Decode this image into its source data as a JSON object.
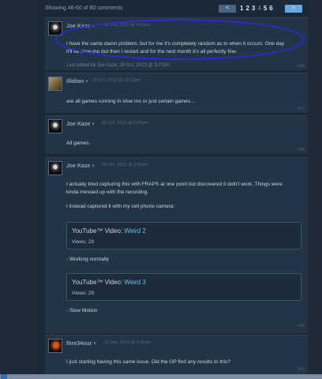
{
  "pager": {
    "showing": "Showing 46-60 of 80 comments",
    "prev": "<",
    "next": ">",
    "pages": [
      "1",
      "2",
      "3",
      "4",
      "5",
      "6"
    ],
    "current_page": "4"
  },
  "comments": [
    {
      "author": "Joe Kaze",
      "caret": "▾",
      "date": "26 Oct, 2013 @ 4:41pm",
      "avatar_icon": "dark-figure-avatar",
      "lines": [
        "I have the same damn problem, but for me it's completely random as to when it occurs. One day",
        "it'll be slow-mo but then I restart and for the next month it's all perfectly fine."
      ],
      "edited": "Last edited by Joe Kaze; 28 Oct, 2013 @ 3:07pm",
      "number": "#46"
    },
    {
      "author": "illidian",
      "caret": "▾",
      "date": "28 Oct, 2013 @ 10:13pm",
      "avatar_icon": "portrait-avatar",
      "lines": [
        "are all games running in slow mo or just certain games…"
      ],
      "number": "#47"
    },
    {
      "author": "Joe Kaze",
      "caret": "▾",
      "date": "30 Oct, 2013 @ 6:05pm",
      "avatar_icon": "dark-figure-avatar",
      "lines": [
        "All games."
      ],
      "number": "#48"
    },
    {
      "author": "Joe Kaze",
      "caret": "▾",
      "date": "30 Oct, 2013 @ 6:59pm",
      "avatar_icon": "dark-figure-avatar",
      "lines": [
        "I actually tried capturing this with FRAPS at one point but discovered it didn't work. Things were",
        "kinda messed up with the recording."
      ],
      "lines2": [
        "I instead captured it with my cell phone camera:"
      ],
      "videos": [
        {
          "prefix": "YouTube™ Video: ",
          "title": "Weird 2",
          "views": "Views: 28",
          "caption": "- Working normally"
        },
        {
          "prefix": "YouTube™ Video: ",
          "title": "Weird 3",
          "views": "Views: 29",
          "caption": "- Slow Motion"
        }
      ],
      "number": "#49"
    },
    {
      "author": "thre34our",
      "caret": "▾",
      "date": "16 Mar, 2014 @ 5:28pm",
      "avatar_icon": "flame-avatar",
      "lines": [
        "I just starting having this same issue. Did the OP find any results to this?"
      ],
      "number": "#50"
    }
  ],
  "colors": {
    "page_bg": "#1b2838",
    "comment_bg": "#243447",
    "link": "#66c0f4",
    "highlight_oval": "#2a2ad8"
  }
}
